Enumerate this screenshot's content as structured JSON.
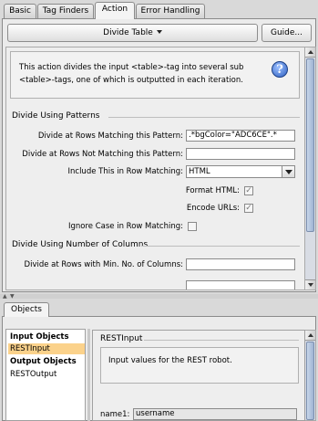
{
  "tabs": [
    {
      "label": "Basic",
      "active": false
    },
    {
      "label": "Tag Finders",
      "active": false
    },
    {
      "label": "Action",
      "active": true
    },
    {
      "label": "Error Handling",
      "active": false
    }
  ],
  "toolbar": {
    "action_label": "Divide Table",
    "guide_label": "Guide..."
  },
  "description": "This action divides the input <table>-tag into several sub <table>-tags, one of which is outputted in each iteration.",
  "help_icon_glyph": "?",
  "patterns": {
    "section_title": "Divide Using Patterns",
    "matching_label": "Divide at Rows Matching this Pattern:",
    "matching_value": ".*bgColor=\"ADC6CE\".*",
    "not_matching_label": "Divide at Rows Not Matching this Pattern:",
    "not_matching_value": "",
    "include_label": "Include This in Row Matching:",
    "include_value": "HTML",
    "format_html_label": "Format HTML:",
    "format_html_checked": true,
    "encode_urls_label": "Encode URLs:",
    "encode_urls_checked": true,
    "ignore_case_label": "Ignore Case in Row Matching:",
    "ignore_case_checked": false
  },
  "columns": {
    "section_title": "Divide Using Number of Columns",
    "min_label": "Divide at Rows with Min. No. of Columns:",
    "min_value": ""
  },
  "bottom": {
    "tab_label": "Objects",
    "list": [
      {
        "label": "Input Objects",
        "bold": true,
        "selected": false
      },
      {
        "label": "RESTInput",
        "bold": false,
        "selected": true
      },
      {
        "label": "Output Objects",
        "bold": true,
        "selected": false
      },
      {
        "label": "RESTOutput",
        "bold": false,
        "selected": false
      }
    ],
    "detail_title": "RESTInput",
    "detail_desc": "Input values for the REST robot.",
    "name_label": "name1:",
    "name_value": "username"
  },
  "check_glyph": "✓",
  "colors": {
    "selection": "#fbd28b",
    "scroll_thumb": "#9fb4d2"
  }
}
